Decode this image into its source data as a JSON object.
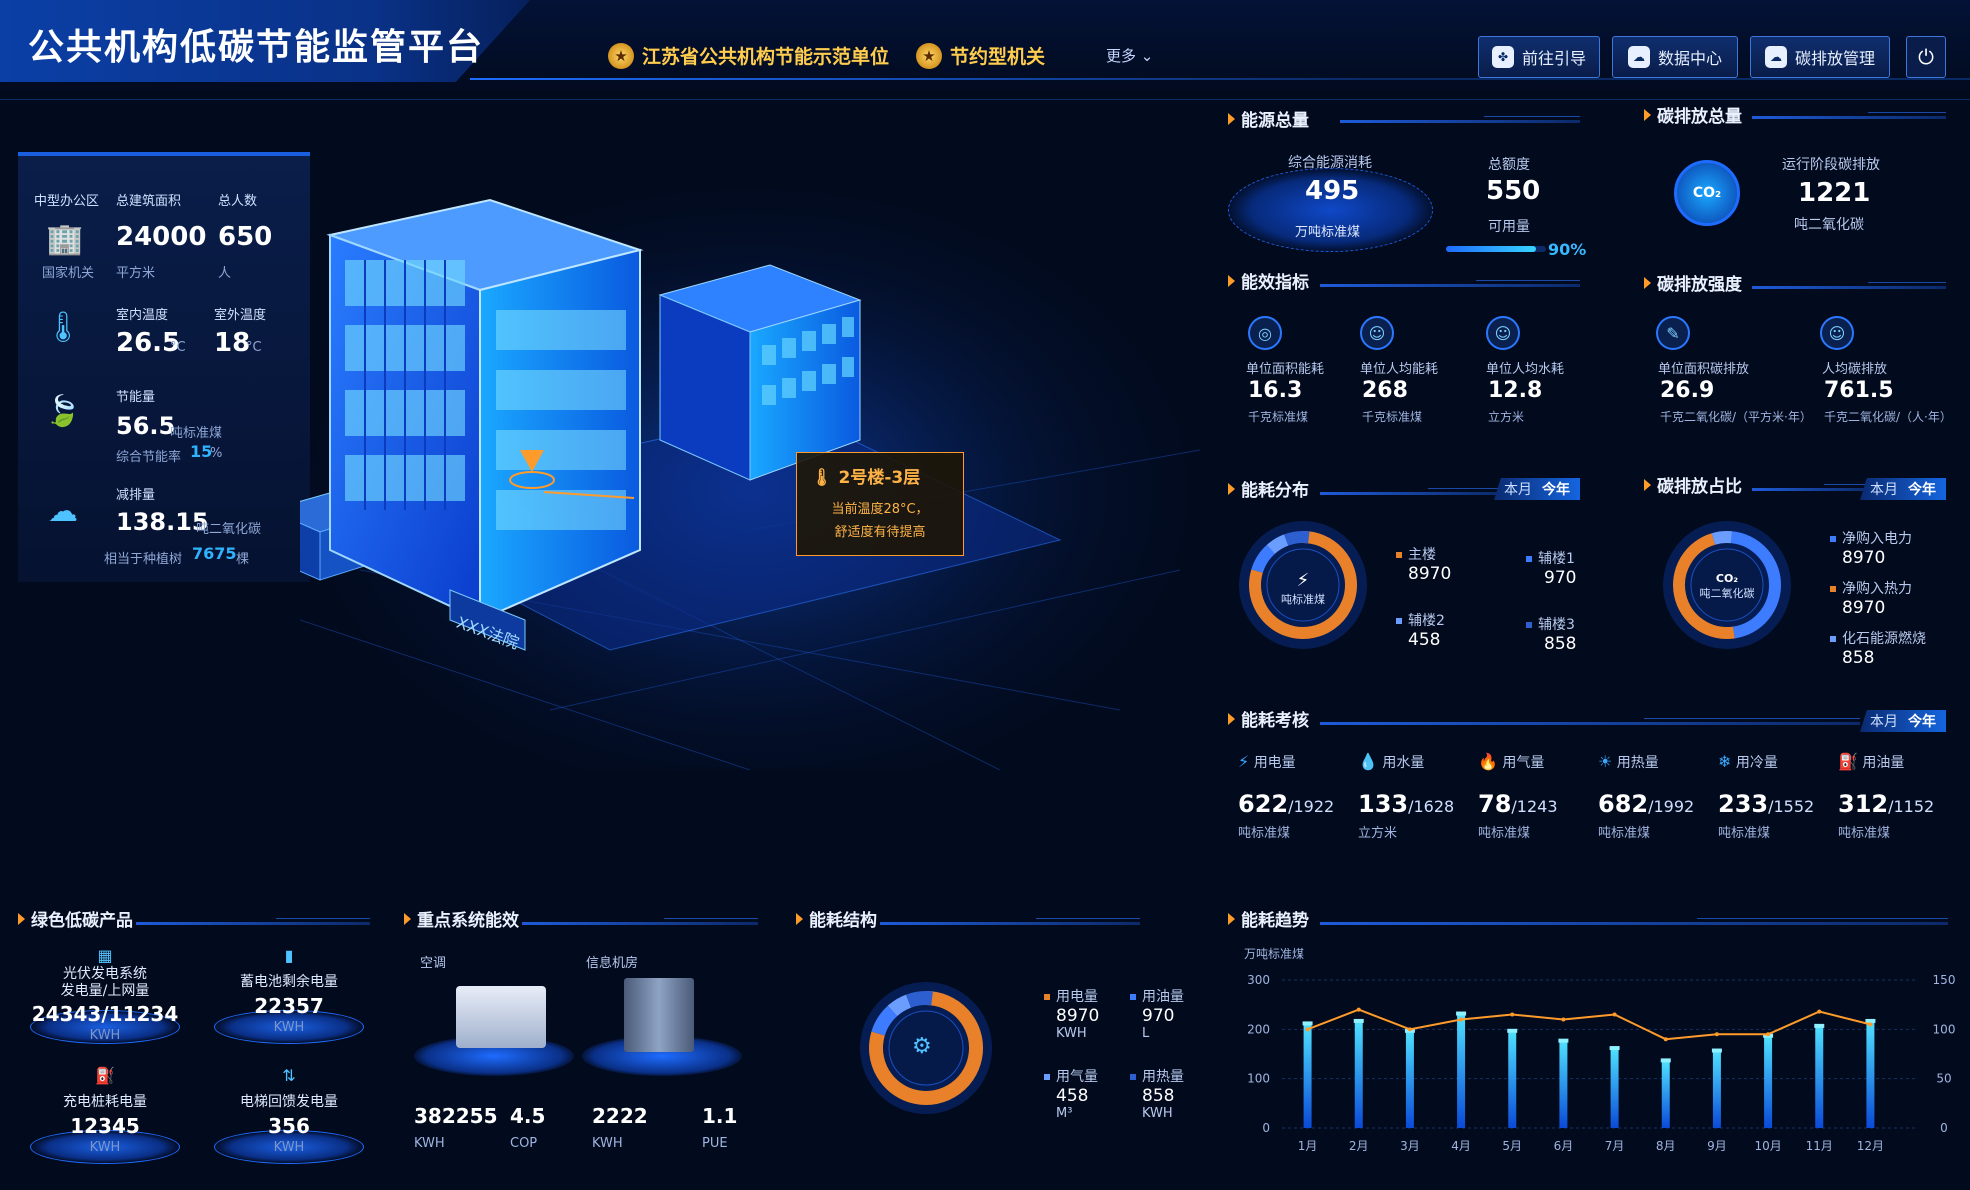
{
  "header": {
    "title": "公共机构低碳节能监管平台",
    "badges": [
      "江苏省公共机构节能示范单位",
      "节约型机关"
    ],
    "more": "更多",
    "nav": [
      "前往引导",
      "数据中心",
      "碳排放管理"
    ],
    "power_icon": "power-icon"
  },
  "left_panel": {
    "org_type": "中型办公区",
    "org_level": "国家机关",
    "area_label": "总建筑面积",
    "area_value": "24000",
    "area_unit": "平方米",
    "people_label": "总人数",
    "people_value": "650",
    "people_unit": "人",
    "indoor_label": "室内温度",
    "indoor_value": "26.5",
    "outdoor_label": "室外温度",
    "outdoor_value": "18",
    "temp_unit": "°C",
    "saving_label": "节能量",
    "saving_value": "56.5",
    "saving_unit": "吨标准煤",
    "saving_rate_label": "综合节能率",
    "saving_rate_value": "15",
    "saving_rate_unit": "%",
    "reduction_label": "减排量",
    "reduction_value": "138.15",
    "reduction_unit": "吨二氧化碳",
    "tree_prefix": "相当于种植树",
    "tree_value": "7675",
    "tree_unit": "棵"
  },
  "building": {
    "sign": "XXX法院",
    "popup_title": "2号楼-3层",
    "popup_line1": "当前温度28°C，",
    "popup_line2": "舒适度有待提高"
  },
  "energy_total": {
    "title": "能源总量",
    "consumption_label": "综合能源消耗",
    "consumption_value": "495",
    "consumption_unit": "万吨标准煤",
    "quota_label": "总额度",
    "quota_value": "550",
    "available_label": "可用量",
    "available_percent": "90%",
    "available_fraction": 0.9
  },
  "carbon_total": {
    "title": "碳排放总量",
    "label": "运行阶段碳排放",
    "value": "1221",
    "unit": "吨二氧化碳",
    "icon": "CO₂"
  },
  "efficiency": {
    "title": "能效指标",
    "items": [
      {
        "label": "单位面积能耗",
        "value": "16.3",
        "unit": "千克标准煤"
      },
      {
        "label": "单位人均能耗",
        "value": "268",
        "unit": "千克标准煤"
      },
      {
        "label": "单位人均水耗",
        "value": "12.8",
        "unit": "立方米"
      }
    ]
  },
  "carbon_intensity": {
    "title": "碳排放强度",
    "items": [
      {
        "label": "单位面积碳排放",
        "value": "26.9",
        "unit": "千克二氧化碳/（平方米·年）"
      },
      {
        "label": "人均碳排放",
        "value": "761.5",
        "unit": "千克二氧化碳/（人·年）"
      }
    ]
  },
  "distribution": {
    "title": "能耗分布",
    "toggle": [
      "本月",
      "今年"
    ],
    "center": "吨标准煤",
    "items": [
      {
        "name": "主楼",
        "value": "8970",
        "color": "#e8812a"
      },
      {
        "name": "辅楼1",
        "value": "970",
        "color": "#3d7bff"
      },
      {
        "name": "辅楼2",
        "value": "458",
        "color": "#6b9dff"
      },
      {
        "name": "辅楼3",
        "value": "858",
        "color": "#2d5fd0"
      }
    ]
  },
  "carbon_share": {
    "title": "碳排放占比",
    "toggle": [
      "本月",
      "今年"
    ],
    "center": "吨二氧化碳",
    "items": [
      {
        "name": "净购入电力",
        "value": "8970",
        "color": "#3d7bff"
      },
      {
        "name": "净购入热力",
        "value": "8970",
        "color": "#e8812a"
      },
      {
        "name": "化石能源燃烧",
        "value": "858",
        "color": "#6b9dff"
      }
    ]
  },
  "assessment": {
    "title": "能耗考核",
    "toggle": [
      "本月",
      "今年"
    ],
    "items": [
      {
        "label": "用电量",
        "value": "622",
        "total": "1922",
        "unit": "吨标准煤",
        "icon": "⚡"
      },
      {
        "label": "用水量",
        "value": "133",
        "total": "1628",
        "unit": "立方米",
        "icon": "💧"
      },
      {
        "label": "用气量",
        "value": "78",
        "total": "1243",
        "unit": "吨标准煤",
        "icon": "🔥"
      },
      {
        "label": "用热量",
        "value": "682",
        "total": "1992",
        "unit": "吨标准煤",
        "icon": "☀"
      },
      {
        "label": "用冷量",
        "value": "233",
        "total": "1552",
        "unit": "吨标准煤",
        "icon": "❄"
      },
      {
        "label": "用油量",
        "value": "312",
        "total": "1152",
        "unit": "吨标准煤",
        "icon": "⛽"
      }
    ]
  },
  "green_products": {
    "title": "绿色低碳产品",
    "items": [
      {
        "label1": "光伏发电系统",
        "label2": "发电量/上网量",
        "value": "24343/11234",
        "unit": "KWH"
      },
      {
        "label1": "蓄电池剩余电量",
        "label2": "",
        "value": "22357",
        "unit": "KWH"
      },
      {
        "label1": "充电桩耗电量",
        "label2": "",
        "value": "12345",
        "unit": "KWH"
      },
      {
        "label1": "电梯回馈发电量",
        "label2": "",
        "value": "356",
        "unit": "KWH"
      }
    ]
  },
  "key_systems": {
    "title": "重点系统能效",
    "ac_label": "空调",
    "room_label": "信息机房",
    "stats": [
      {
        "value": "382255",
        "unit": "KWH"
      },
      {
        "value": "4.5",
        "unit": "COP"
      },
      {
        "value": "2222",
        "unit": "KWH"
      },
      {
        "value": "1.1",
        "unit": "PUE"
      }
    ]
  },
  "structure": {
    "title": "能耗结构",
    "items": [
      {
        "name": "用电量",
        "value": "8970",
        "unit": "KWH",
        "color": "#e8812a"
      },
      {
        "name": "用油量",
        "value": "970",
        "unit": "L",
        "color": "#3d7bff"
      },
      {
        "name": "用气量",
        "value": "458",
        "unit": "M³",
        "color": "#6b9dff"
      },
      {
        "name": "用热量",
        "value": "858",
        "unit": "KWH",
        "color": "#2d5fd0"
      }
    ]
  },
  "trend": {
    "title": "能耗趋势"
  },
  "chart_data": {
    "type": "bar",
    "title": "",
    "ylabel": "万吨标准煤",
    "categories": [
      "1月",
      "2月",
      "3月",
      "4月",
      "5月",
      "6月",
      "7月",
      "8月",
      "9月",
      "10月",
      "11月",
      "12月"
    ],
    "ylim": [
      0,
      300
    ],
    "y2lim": [
      0,
      150
    ],
    "yticks": [
      0,
      100,
      200,
      300
    ],
    "y2ticks": [
      0,
      50,
      100,
      150
    ],
    "series": [
      {
        "type": "bar",
        "values": [
          210,
          215,
          195,
          230,
          195,
          175,
          160,
          135,
          155,
          185,
          205,
          215
        ]
      },
      {
        "type": "line",
        "axis": "right",
        "values": [
          100,
          120,
          100,
          110,
          115,
          110,
          115,
          90,
          95,
          95,
          118,
          105
        ]
      }
    ]
  }
}
